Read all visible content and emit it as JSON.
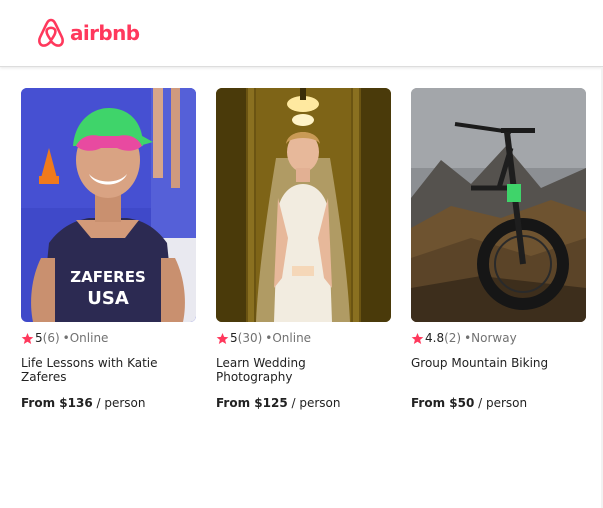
{
  "brand": {
    "name": "airbnb",
    "color": "#FF385C"
  },
  "colors": {
    "accent": "#FF385C",
    "text": "#222222",
    "muted": "#717171"
  },
  "experiences": [
    {
      "photo_icon": "athlete-photo",
      "rating": "5",
      "reviews": "(6)",
      "separator": "•",
      "location": "Online",
      "title": "Life Lessons with Katie Zaferes",
      "price_prefix": "From $136",
      "price_suffix": " / person",
      "jersey_text_1": "ZAFERES",
      "jersey_text_2": "USA"
    },
    {
      "photo_icon": "bride-photo",
      "rating": "5",
      "reviews": "(30)",
      "separator": "•",
      "location": "Online",
      "title": "Learn Wedding Photography",
      "price_prefix": "From $125",
      "price_suffix": " / person"
    },
    {
      "photo_icon": "mountain-bike-photo",
      "rating": "4.8",
      "reviews": "(2)",
      "separator": "•",
      "location": "Norway",
      "title": "Group Mountain Biking",
      "price_prefix": "From $50",
      "price_suffix": " / person"
    }
  ]
}
